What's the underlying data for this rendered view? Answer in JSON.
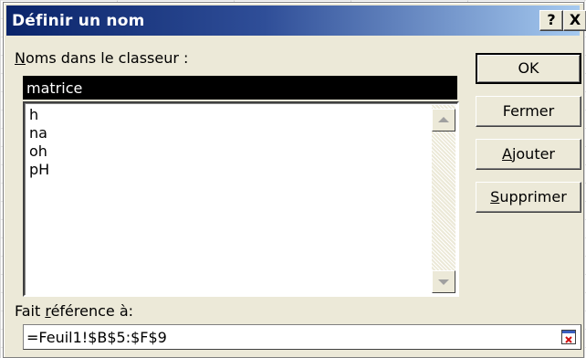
{
  "dialog": {
    "title": "Définir un nom",
    "help_button": "?",
    "close_button": "X"
  },
  "names_label": {
    "underlined_char": "N",
    "rest": "oms dans le classeur :"
  },
  "name_field": {
    "value": "matrice"
  },
  "names_list": [
    "h",
    "na",
    "oh",
    "pH"
  ],
  "buttons": {
    "ok": "OK",
    "close": "Fermer",
    "add_underlined": "A",
    "add_rest": "jouter",
    "delete_underlined": "S",
    "delete_rest": "upprimer"
  },
  "reference_label": {
    "before": "Fait ",
    "underlined_char": "r",
    "after": "éférence à:"
  },
  "reference_field": {
    "value": "=Feuil1!$B$5:$F$9"
  },
  "colors": {
    "title_start": "#0a246a",
    "title_end": "#a6caf0",
    "dialog_bg": "#ece9d8"
  }
}
